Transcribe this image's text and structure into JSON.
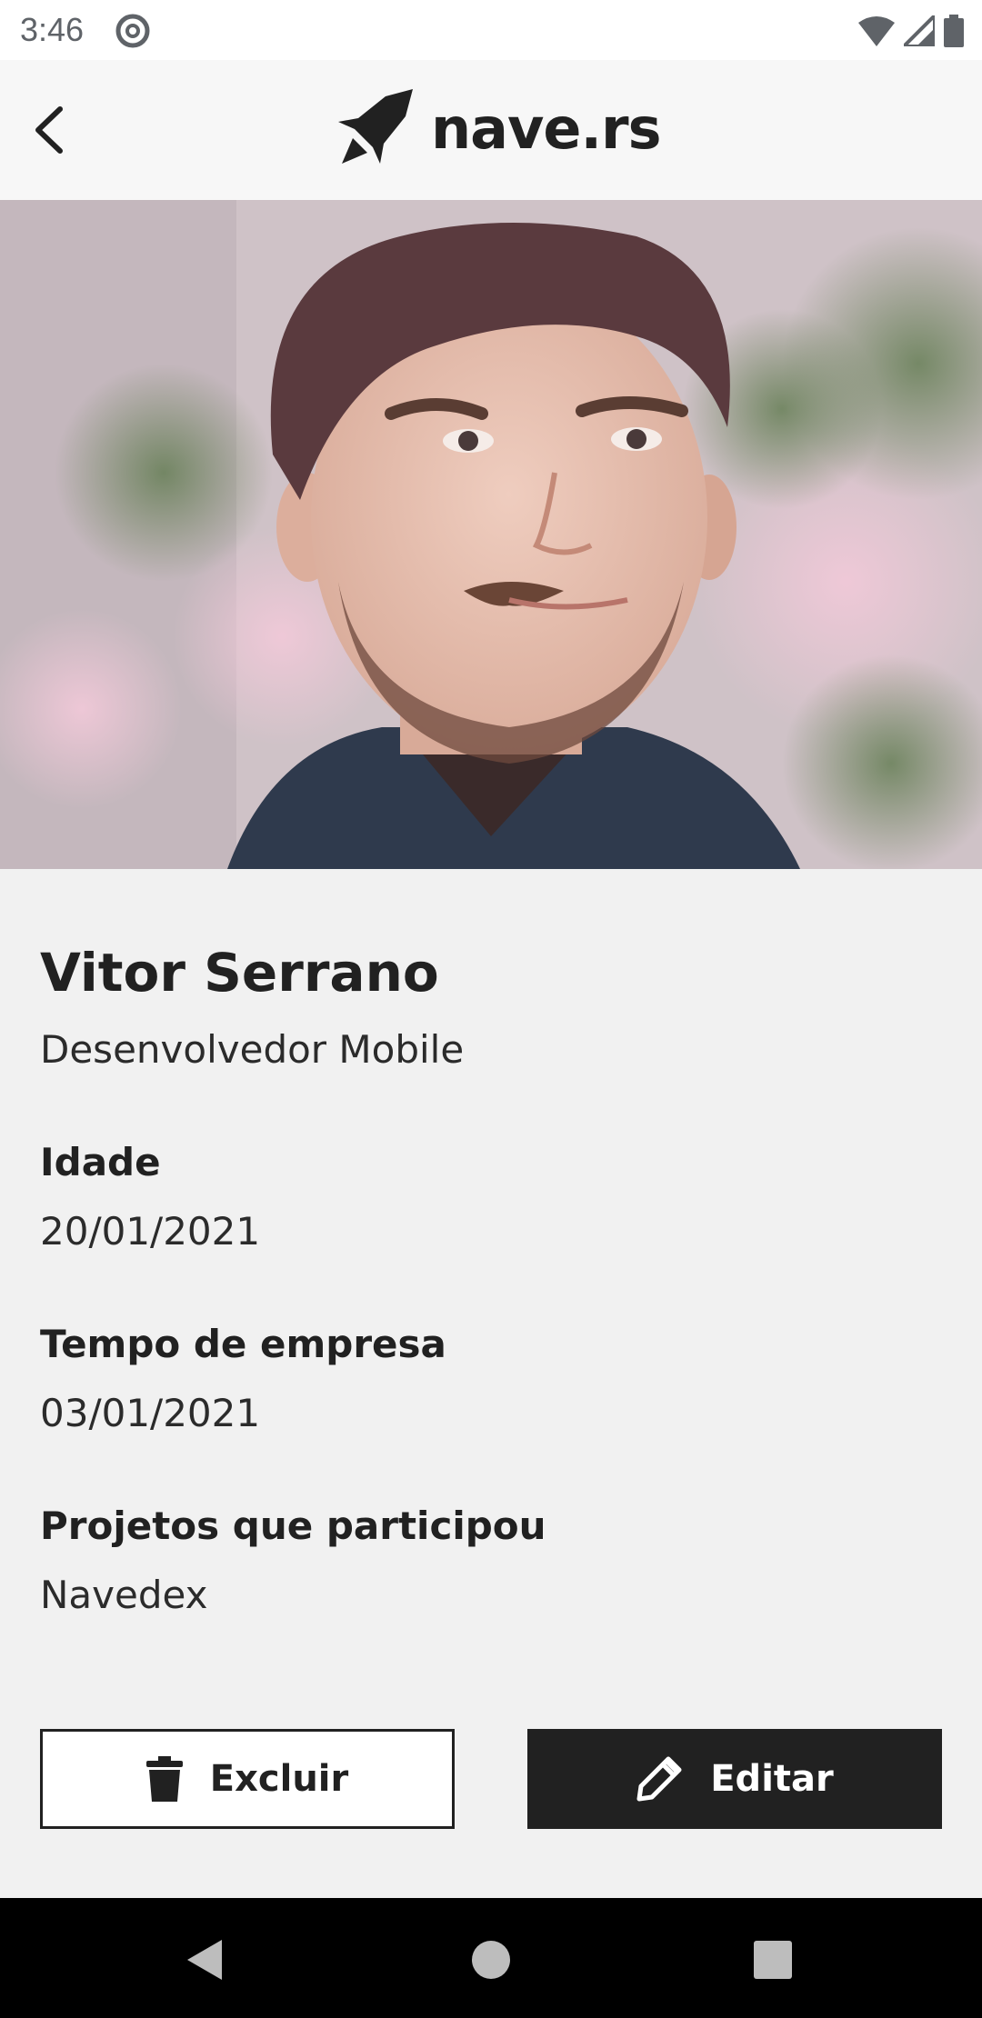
{
  "status_bar": {
    "time": "3:46"
  },
  "app_bar": {
    "logo_text": "nave.rs",
    "icons": {
      "back": "chevron-left-icon",
      "logo": "rocket-icon"
    }
  },
  "profile": {
    "name": "Vitor Serrano",
    "role": "Desenvolvedor Mobile",
    "fields": [
      {
        "label": "Idade",
        "value": "20/01/2021"
      },
      {
        "label": "Tempo de empresa",
        "value": "03/01/2021"
      },
      {
        "label": "Projetos que participou",
        "value": "Navedex"
      }
    ]
  },
  "actions": {
    "delete_label": "Excluir",
    "edit_label": "Editar",
    "delete_icon": "trash-icon",
    "edit_icon": "pencil-icon"
  },
  "colors": {
    "primary": "#212121",
    "background": "#f1f1f1",
    "surface": "#ffffff"
  }
}
